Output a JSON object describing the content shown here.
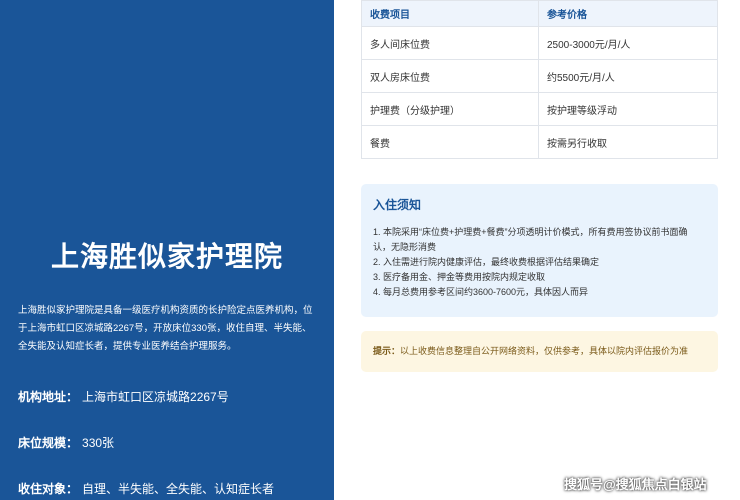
{
  "institution": {
    "name": "上海胜似家护理院",
    "description": "上海胜似家护理院是具备一级医疗机构资质的长护险定点医养机构，位于上海市虹口区凉城路2267号，开放床位330张，收住自理、半失能、全失能及认知症长者，提供专业医养结合护理服务。",
    "info": [
      {
        "label": "机构地址：",
        "value": "上海市虹口区凉城路2267号"
      },
      {
        "label": "床位规模：",
        "value": "330张"
      },
      {
        "label": "收住对象：",
        "value": "自理、半失能、全失能、认知症长者"
      }
    ]
  },
  "fee_table": {
    "headers": [
      "收费项目",
      "参考价格"
    ],
    "rows": [
      [
        "多人间床位费",
        "2500-3000元/月/人"
      ],
      [
        "双人房床位费",
        "约5500元/月/人"
      ],
      [
        "护理费（分级护理）",
        "按护理等级浮动"
      ],
      [
        "餐费",
        "按需另行收取"
      ]
    ]
  },
  "notice": {
    "title": "入住须知",
    "items": [
      "1. 本院采用“床位费+护理费+餐费”分项透明计价模式，所有费用签协议前书面确",
      "认，无隐形消费",
      "2. 入住需进行院内健康评估，最终收费根据评估结果确定",
      "3. 医疗备用金、押金等费用按院内规定收取",
      "4. 每月总费用参考区间约3600-7600元，具体因人而异"
    ]
  },
  "tip": {
    "label": "提示：",
    "text": "以上收费信息整理自公开网络资料，仅供参考，具体以院内评估报价为准"
  },
  "watermark": "搜狐号@搜狐焦点白银站",
  "colors": {
    "primary": "#1a5598",
    "notice_bg": "#e9f3fd",
    "tip_bg": "#fdf6e2"
  }
}
